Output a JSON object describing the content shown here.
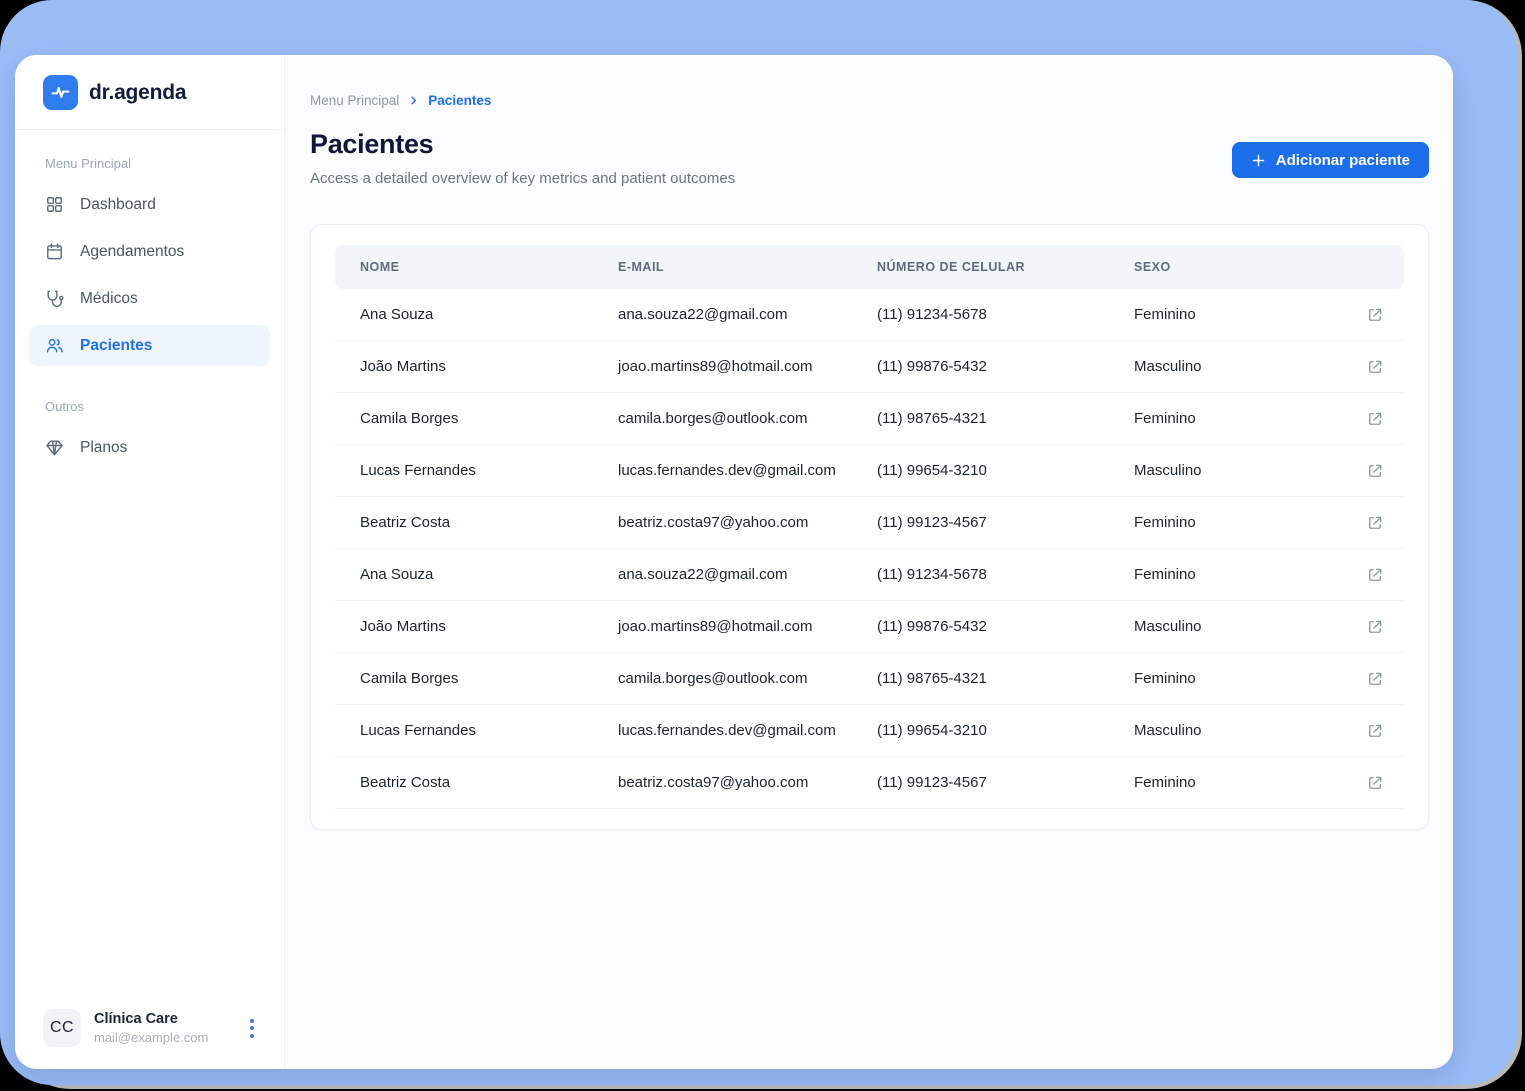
{
  "app": {
    "name": "dr.agenda"
  },
  "colors": {
    "accent_blue": "#1C6FE8",
    "frame_blue": "#9ABDF8",
    "active_item_bg": "#EFF5FD",
    "logo_bg": "#2E7CEE",
    "table_header_bg": "#F2F6FB"
  },
  "sidebar": {
    "sections": [
      {
        "label": "Menu Principal",
        "items": [
          {
            "label": "Dashboard"
          },
          {
            "label": "Agendamentos"
          },
          {
            "label": "Médicos"
          },
          {
            "label": "Pacientes"
          }
        ]
      },
      {
        "label": "Outros",
        "items": [
          {
            "label": "Planos"
          }
        ]
      }
    ],
    "account": {
      "initials": "CC",
      "name": "Clínica Care",
      "email": "mail@example.com"
    }
  },
  "breadcrumb": {
    "parent": "Menu Principal",
    "current": "Pacientes"
  },
  "page": {
    "title": "Pacientes",
    "subtitle": "Access a detailed overview of key metrics and patient outcomes",
    "add_button_label": "Adicionar paciente"
  },
  "table": {
    "columns": [
      "NOME",
      "E-MAIL",
      "NÚMERO DE CELULAR",
      "SEXO"
    ],
    "rows": [
      {
        "name": "Ana Souza",
        "email": "ana.souza22@gmail.com",
        "phone": "(11) 91234-5678",
        "sex": "Feminino"
      },
      {
        "name": "João Martins",
        "email": "joao.martins89@hotmail.com",
        "phone": "(11) 99876-5432",
        "sex": "Masculino"
      },
      {
        "name": "Camila Borges",
        "email": "camila.borges@outlook.com",
        "phone": "(11) 98765-4321",
        "sex": "Feminino"
      },
      {
        "name": "Lucas Fernandes",
        "email": "lucas.fernandes.dev@gmail.com",
        "phone": "(11) 99654-3210",
        "sex": "Masculino"
      },
      {
        "name": "Beatriz Costa",
        "email": "beatriz.costa97@yahoo.com",
        "phone": "(11) 99123-4567",
        "sex": "Feminino"
      },
      {
        "name": "Ana Souza",
        "email": "ana.souza22@gmail.com",
        "phone": "(11) 91234-5678",
        "sex": "Feminino"
      },
      {
        "name": "João Martins",
        "email": "joao.martins89@hotmail.com",
        "phone": "(11) 99876-5432",
        "sex": "Masculino"
      },
      {
        "name": "Camila Borges",
        "email": "camila.borges@outlook.com",
        "phone": "(11) 98765-4321",
        "sex": "Feminino"
      },
      {
        "name": "Lucas Fernandes",
        "email": "lucas.fernandes.dev@gmail.com",
        "phone": "(11) 99654-3210",
        "sex": "Masculino"
      },
      {
        "name": "Beatriz Costa",
        "email": "beatriz.costa97@yahoo.com",
        "phone": "(11) 99123-4567",
        "sex": "Feminino"
      }
    ]
  }
}
